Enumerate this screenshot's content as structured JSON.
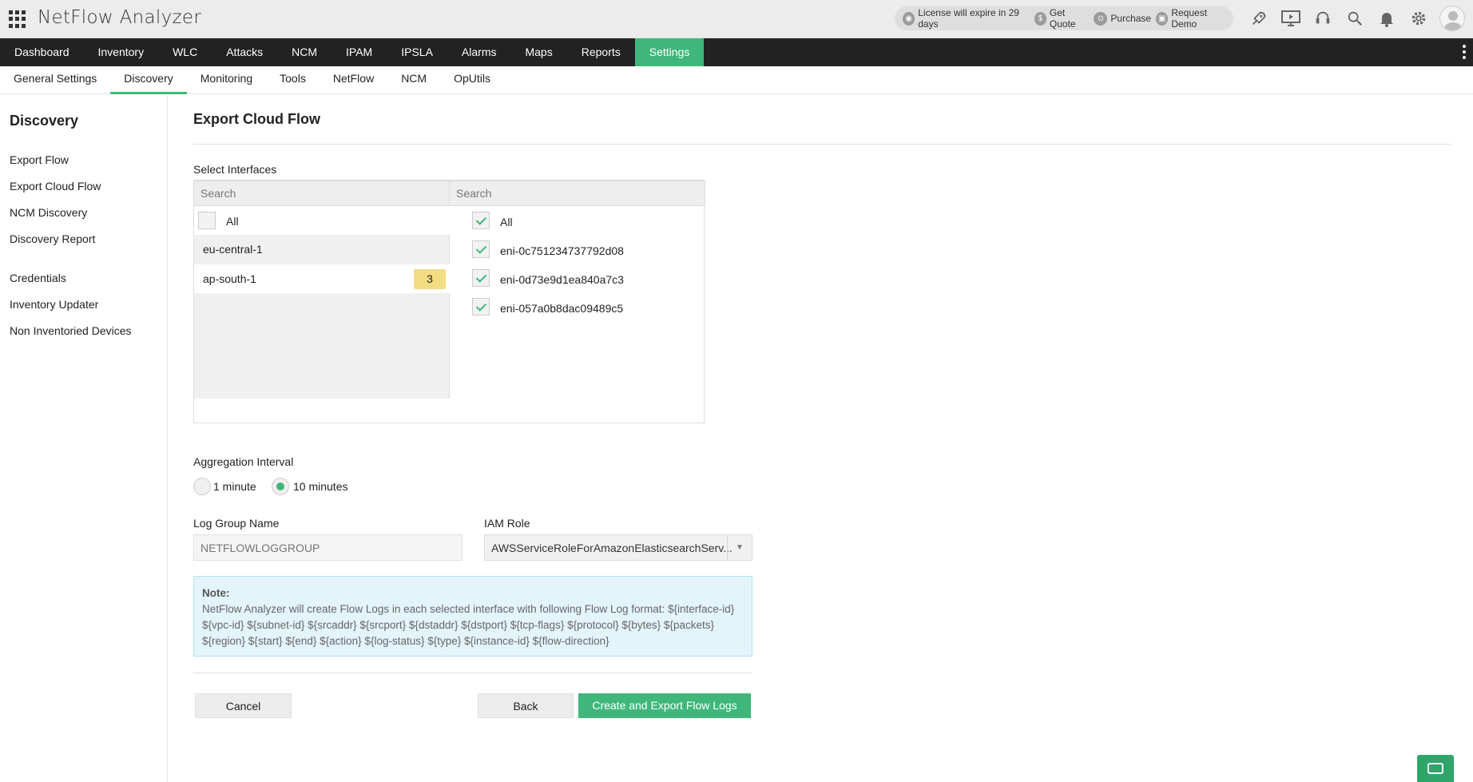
{
  "app": {
    "title": "NetFlow Analyzer"
  },
  "header": {
    "license_text": "License will expire in 29 days",
    "get_quote": "Get Quote",
    "purchase": "Purchase",
    "request_demo": "Request Demo"
  },
  "main_nav": {
    "items": [
      "Dashboard",
      "Inventory",
      "WLC",
      "Attacks",
      "NCM",
      "IPAM",
      "IPSLA",
      "Alarms",
      "Maps",
      "Reports",
      "Settings"
    ],
    "active": "Settings"
  },
  "sub_nav": {
    "items": [
      "General Settings",
      "Discovery",
      "Monitoring",
      "Tools",
      "NetFlow",
      "NCM",
      "OpUtils"
    ],
    "active": "Discovery"
  },
  "sidebar": {
    "title": "Discovery",
    "group1": [
      "Export Flow",
      "Export Cloud Flow",
      "NCM Discovery",
      "Discovery Report"
    ],
    "group2": [
      "Credentials",
      "Inventory Updater",
      "Non Inventoried Devices"
    ]
  },
  "page": {
    "title": "Export Cloud Flow",
    "select_interfaces_label": "Select Interfaces",
    "left_search_placeholder": "Search",
    "right_search_placeholder": "Search",
    "left_all_label": "All",
    "regions": [
      {
        "name": "eu-central-1",
        "count": ""
      },
      {
        "name": "ap-south-1",
        "count": "3"
      }
    ],
    "right_all_label": "All",
    "interfaces": [
      "eni-0c751234737792d08",
      "eni-0d73e9d1ea840a7c3",
      "eni-057a0b8dac09489c5"
    ],
    "aggregation_label": "Aggregation Interval",
    "aggregation_options": [
      "1 minute",
      "10 minutes"
    ],
    "aggregation_selected": "10 minutes",
    "log_group_label": "Log Group Name",
    "log_group_placeholder": "NETFLOWLOGGROUP",
    "iam_role_label": "IAM Role",
    "iam_role_value": "AWSServiceRoleForAmazonElasticsearchServ...",
    "note_title": "Note:",
    "note_text": "NetFlow Analyzer will create Flow Logs in each selected interface with following Flow Log format: ${interface-id} ${vpc-id} ${subnet-id} ${srcaddr} ${srcport} ${dstaddr} ${dstport} ${tcp-flags} ${protocol} ${bytes} ${packets} ${region} ${start} ${end} ${action} ${log-status} ${type} ${instance-id} ${flow-direction}",
    "cancel_label": "Cancel",
    "back_label": "Back",
    "create_label": "Create and Export Flow Logs"
  },
  "colors": {
    "accent": "#3fb77a",
    "nav_bg": "#222222",
    "badge": "#f3dc82",
    "note_bg": "#e3f4fb"
  },
  "icons": [
    "apps-grid-icon",
    "rocket-icon",
    "presentation-icon",
    "headset-icon",
    "search-icon",
    "bell-icon",
    "gear-icon",
    "avatar",
    "chat-icon"
  ]
}
